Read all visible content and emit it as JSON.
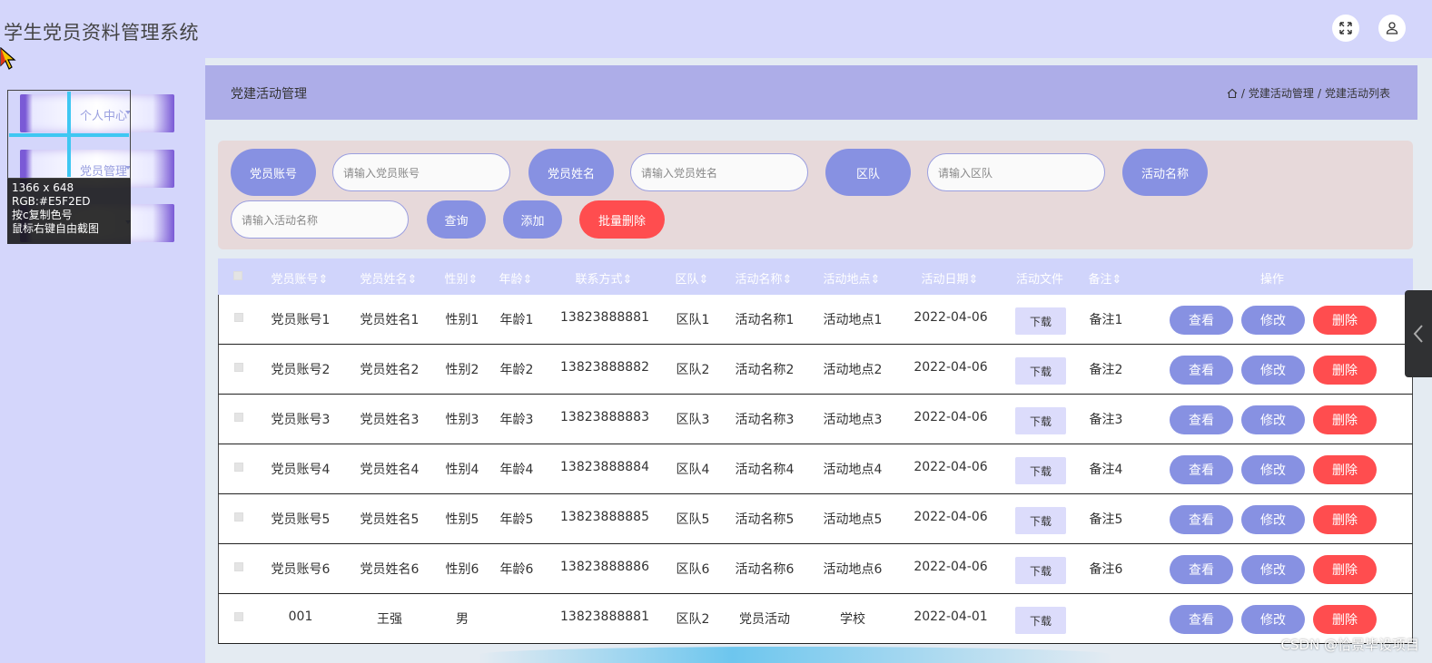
{
  "app": {
    "title": "学生党员资料管理系统"
  },
  "header_icons": {
    "fullscreen": "expand-icon",
    "user": "user-icon"
  },
  "sidebar": {
    "items": [
      {
        "label": "个人中心"
      },
      {
        "label": "党员管理"
      },
      {
        "label": ""
      }
    ]
  },
  "color_picker": {
    "line1": "1366 x 648",
    "line2": "RGB:#E5F2ED",
    "line3": "按c复制色号",
    "line4": "鼠标右键自由截图"
  },
  "page": {
    "title": "党建活动管理",
    "breadcrumb": [
      "党建活动管理",
      "党建活动列表"
    ]
  },
  "search": {
    "account_label": "党员账号",
    "account_placeholder": "请输入党员账号",
    "name_label": "党员姓名",
    "name_placeholder": "请输入党员姓名",
    "team_label": "区队",
    "team_placeholder": "请输入区队",
    "activity_label": "活动名称",
    "activity_placeholder": "请输入活动名称",
    "query_btn": "查询",
    "add_btn": "添加",
    "batch_delete_btn": "批量删除"
  },
  "table": {
    "headers": [
      "党员账号",
      "党员姓名",
      "性别",
      "年龄",
      "联系方式",
      "区队",
      "活动名称",
      "活动地点",
      "活动日期",
      "活动文件",
      "备注",
      "操作"
    ],
    "download_label": "下载",
    "view_label": "查看",
    "edit_label": "修改",
    "delete_label": "删除",
    "rows": [
      {
        "account": "党员账号1",
        "name": "党员姓名1",
        "gender": "性别1",
        "age": "年龄1",
        "phone": "13823888881",
        "team": "区队1",
        "activity": "活动名称1",
        "place": "活动地点1",
        "date": "2022-04-06",
        "remark": "备注1"
      },
      {
        "account": "党员账号2",
        "name": "党员姓名2",
        "gender": "性别2",
        "age": "年龄2",
        "phone": "13823888882",
        "team": "区队2",
        "activity": "活动名称2",
        "place": "活动地点2",
        "date": "2022-04-06",
        "remark": "备注2"
      },
      {
        "account": "党员账号3",
        "name": "党员姓名3",
        "gender": "性别3",
        "age": "年龄3",
        "phone": "13823888883",
        "team": "区队3",
        "activity": "活动名称3",
        "place": "活动地点3",
        "date": "2022-04-06",
        "remark": "备注3"
      },
      {
        "account": "党员账号4",
        "name": "党员姓名4",
        "gender": "性别4",
        "age": "年龄4",
        "phone": "13823888884",
        "team": "区队4",
        "activity": "活动名称4",
        "place": "活动地点4",
        "date": "2022-04-06",
        "remark": "备注4"
      },
      {
        "account": "党员账号5",
        "name": "党员姓名5",
        "gender": "性别5",
        "age": "年龄5",
        "phone": "13823888885",
        "team": "区队5",
        "activity": "活动名称5",
        "place": "活动地点5",
        "date": "2022-04-06",
        "remark": "备注5"
      },
      {
        "account": "党员账号6",
        "name": "党员姓名6",
        "gender": "性别6",
        "age": "年龄6",
        "phone": "13823888886",
        "team": "区队6",
        "activity": "活动名称6",
        "place": "活动地点6",
        "date": "2022-04-06",
        "remark": "备注6"
      },
      {
        "account": "001",
        "name": "王强",
        "gender": "男",
        "age": "",
        "phone": "13823888881",
        "team": "区队2",
        "activity": "党员活动",
        "place": "学校",
        "date": "2022-04-01",
        "remark": ""
      }
    ]
  },
  "watermark": "CSDN @恰景毕设项目",
  "colors": {
    "accent": "#8791e2",
    "danger": "#ff4d4f",
    "header_bg": "#d4d6fb",
    "page_head_bg": "#adade8"
  }
}
